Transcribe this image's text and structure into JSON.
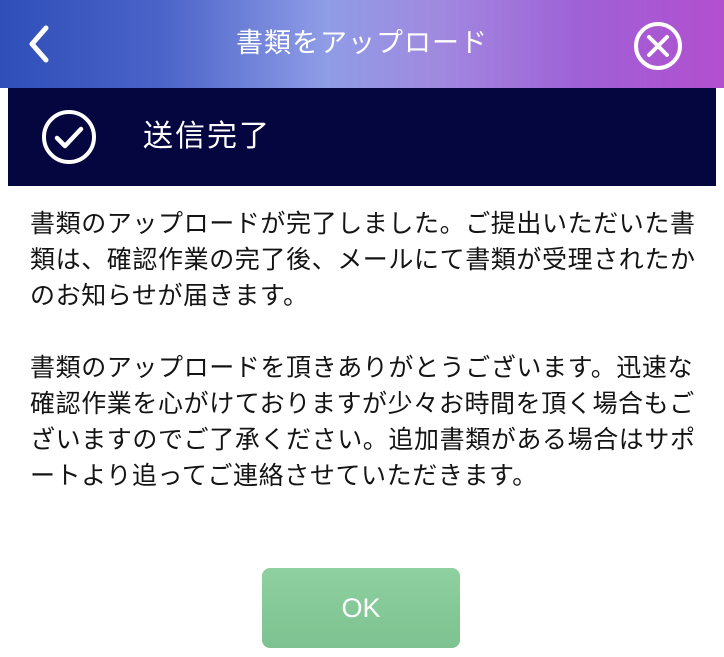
{
  "header": {
    "title": "書類をアップロード",
    "back_icon": "chevron-left-icon",
    "close_icon": "close-circle-icon"
  },
  "status": {
    "icon": "check-circle-icon",
    "text": "送信完了"
  },
  "message": {
    "paragraph1": "書類のアップロードが完了しました。ご提出いただいた書類は、確認作業の完了後、メールにて書類が受理されたかのお知らせが届きます。",
    "paragraph2": "書類のアップロードを頂きありがとうございます。迅速な確認作業を心がけておりますが少々お時間を頂く場合もございますのでご了承ください。追加書類がある場合はサポートより追ってご連絡させていただきます。"
  },
  "ok_button": {
    "label": "OK"
  },
  "colors": {
    "status_bar": "#05053f",
    "ok_button": "#85c897",
    "header_gradient_start": "#2f4fb8",
    "header_gradient_end": "#b24fcf"
  }
}
